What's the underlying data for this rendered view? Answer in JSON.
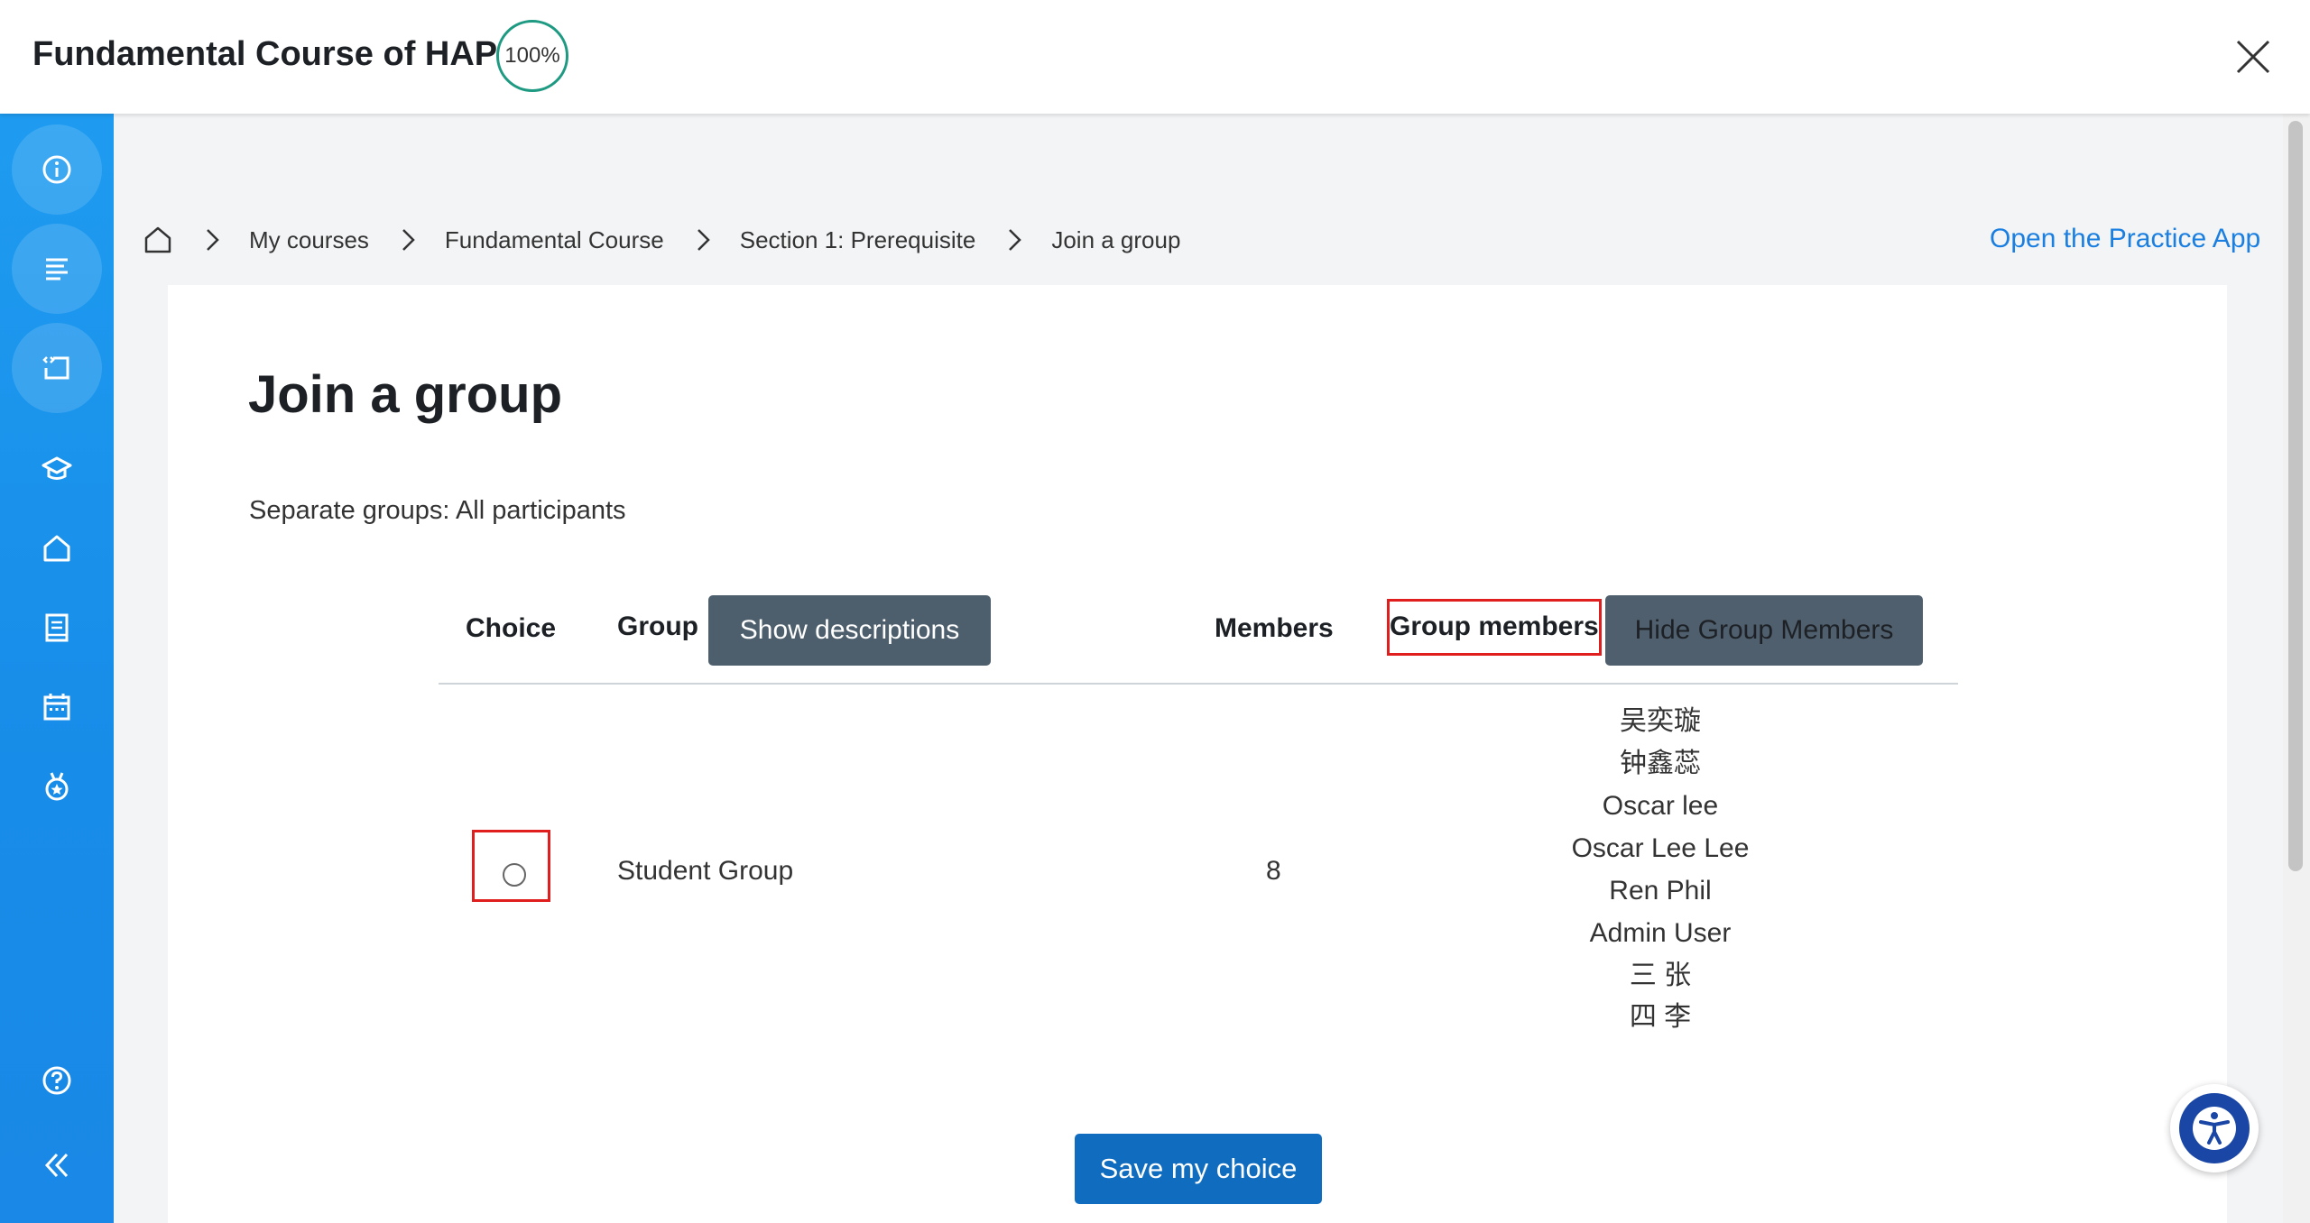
{
  "header": {
    "title": "Fundamental Course of HAP",
    "progress": "100%"
  },
  "sidebar": {
    "items": [
      {
        "icon": "info-icon"
      },
      {
        "icon": "list-icon"
      },
      {
        "icon": "code-window-icon"
      },
      {
        "icon": "graduation-cap-icon"
      },
      {
        "icon": "home-icon"
      },
      {
        "icon": "book-icon"
      },
      {
        "icon": "calendar-icon"
      },
      {
        "icon": "medal-icon"
      },
      {
        "icon": "help-icon"
      },
      {
        "icon": "collapse-icon"
      }
    ]
  },
  "breadcrumb": {
    "items": [
      "My courses",
      "Fundamental Course",
      "Section 1: Prerequisite",
      "Join a group"
    ]
  },
  "practice_link": "Open the Practice App",
  "main": {
    "title": "Join a group",
    "groups_mode": "Separate groups: All participants",
    "table": {
      "headers": {
        "choice": "Choice",
        "group": "Group",
        "show_descriptions": "Show descriptions",
        "members": "Members",
        "group_members": "Group members",
        "hide_group_members": "Hide Group Members"
      },
      "rows": [
        {
          "group": "Student Group",
          "members_count": "8",
          "members": [
            "吴奕璇",
            "钟鑫蕊",
            "Oscar lee",
            "Oscar Lee Lee",
            "Ren Phil",
            "Admin User",
            "三 张",
            "四 李"
          ]
        }
      ]
    },
    "save_button": "Save my choice"
  },
  "colors": {
    "sidebar": "#1e9bf0",
    "primary_button": "#0f6cbf",
    "slate_button": "#4d5e6c",
    "link": "#1a7fe0",
    "highlight": "#e01e1e",
    "progress_ring": "#1e9a82"
  }
}
